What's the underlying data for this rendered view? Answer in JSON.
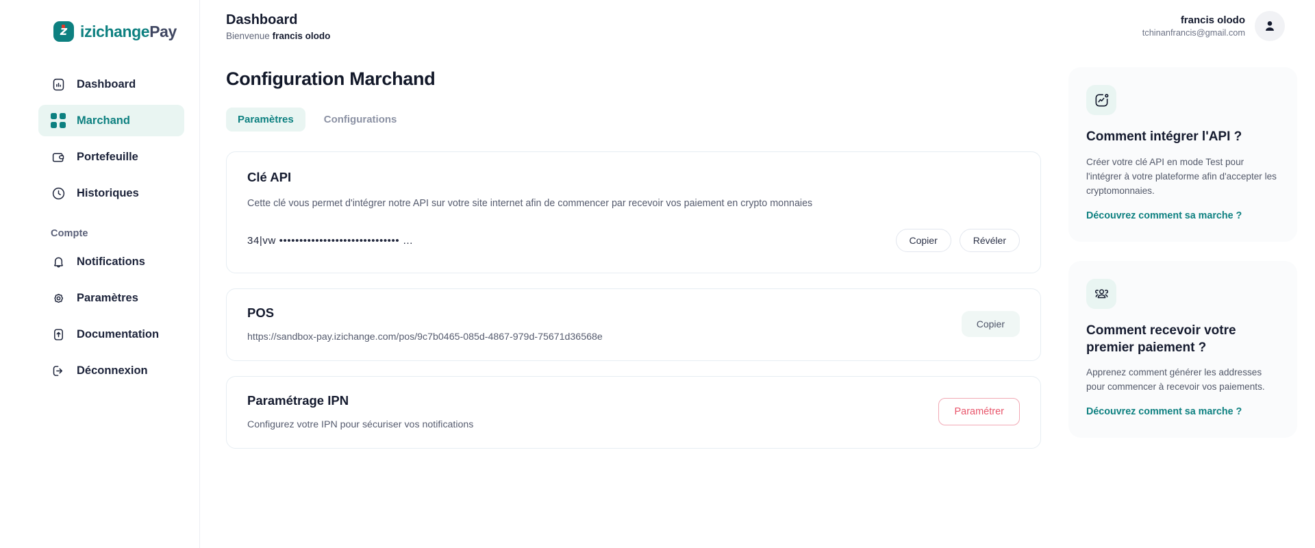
{
  "brand": {
    "logo_letter": "z",
    "name_part1": "izichange",
    "name_part2": "Pay",
    "teal": "#0d8080",
    "accent_red": "#e0392b"
  },
  "sidebar": {
    "items": [
      {
        "label": "Dashboard",
        "icon": "chart-bar-icon",
        "active": false
      },
      {
        "label": "Marchand",
        "icon": "grid-dots-icon",
        "active": true
      },
      {
        "label": "Portefeuille",
        "icon": "wallet-icon",
        "active": false
      },
      {
        "label": "Historiques",
        "icon": "clock-icon",
        "active": false
      }
    ],
    "section_label": "Compte",
    "account_items": [
      {
        "label": "Notifications",
        "icon": "bell-icon"
      },
      {
        "label": "Paramètres",
        "icon": "gear-icon"
      },
      {
        "label": "Documentation",
        "icon": "document-upload-icon"
      },
      {
        "label": "Déconnexion",
        "icon": "logout-icon"
      }
    ]
  },
  "header": {
    "title": "Dashboard",
    "welcome_prefix": "Bienvenue",
    "welcome_name": "francis olodo",
    "user_name": "francis olodo",
    "user_email": "tchinanfrancis@gmail.com",
    "avatar_icon": "user-icon"
  },
  "page": {
    "title": "Configuration Marchand",
    "tabs": [
      {
        "label": "Paramètres",
        "active": true
      },
      {
        "label": "Configurations",
        "active": false
      }
    ]
  },
  "api_card": {
    "title": "Clé API",
    "description": "Cette clé vous permet d'intégrer notre API sur votre site internet afin de commencer par recevoir vos paiement en crypto monnaies",
    "key_value": "34|vw •••••••••••••••••••••••••••••• …",
    "copy_label": "Copier",
    "reveal_label": "Révéler"
  },
  "pos_card": {
    "title": "POS",
    "url": "https://sandbox-pay.izichange.com/pos/9c7b0465-085d-4867-979d-75671d36568e",
    "copy_label": "Copier"
  },
  "ipn_card": {
    "title": "Paramétrage IPN",
    "description": "Configurez votre IPN pour sécuriser vos notifications",
    "button_label": "Paramétrer",
    "button_color": "#e8556b"
  },
  "help_cards": [
    {
      "icon": "activity-chart-icon",
      "title": "Comment intégrer l'API ?",
      "text": "Créer votre clé API en mode Test pour l'intégrer à votre plateforme afin d'accepter les cryptomonnaies.",
      "link": "Découvrez comment sa marche ?"
    },
    {
      "icon": "users-group-icon",
      "title": "Comment recevoir votre premier paiement ?",
      "text": "Apprenez comment générer les addresses pour commencer à recevoir vos paiements.",
      "link": "Découvrez comment sa marche ?"
    }
  ]
}
